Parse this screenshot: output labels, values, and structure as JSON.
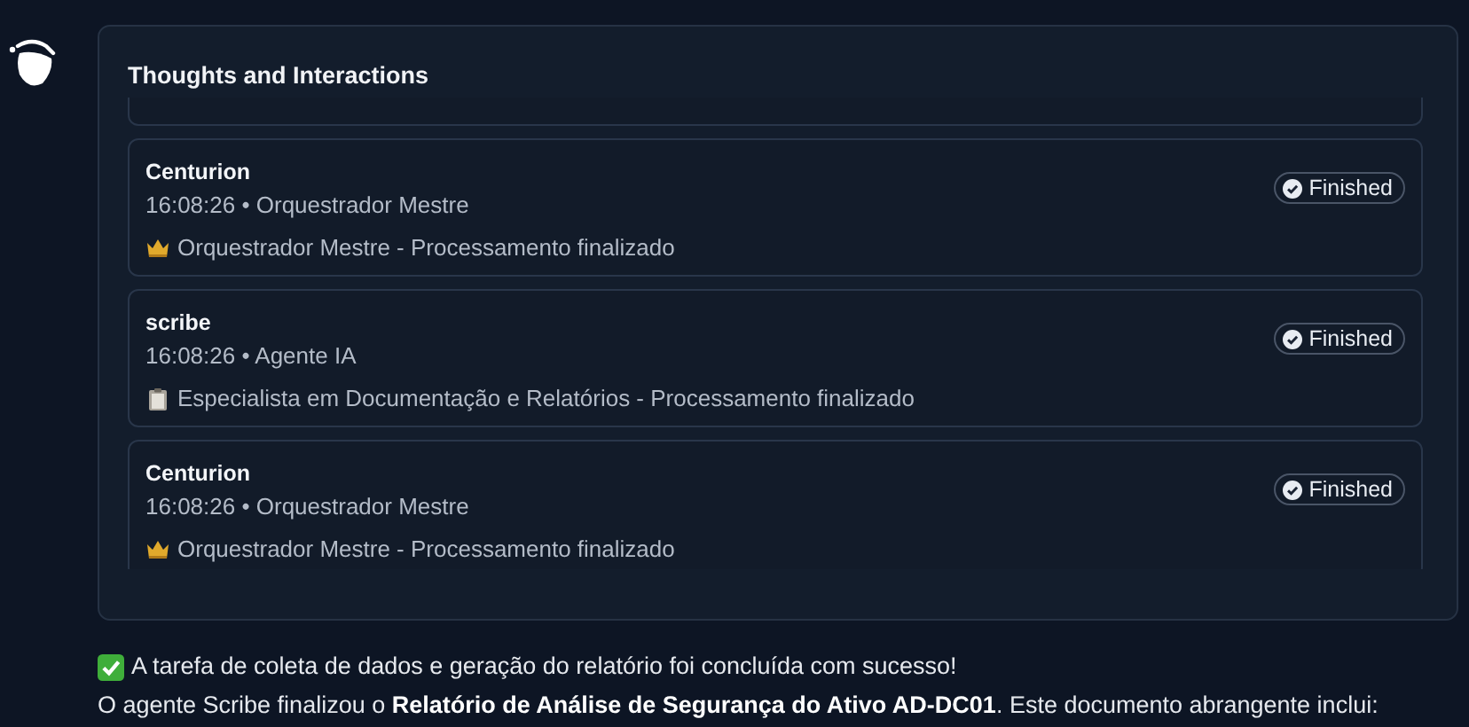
{
  "panel": {
    "title": "Thoughts and Interactions"
  },
  "entries": [
    {
      "agent": "Centurion",
      "meta": "16:08:26 • Orquestrador Mestre",
      "kind": "orchestrator",
      "message": "Orquestrador Mestre - Processamento finalizado",
      "status": "Finished"
    },
    {
      "agent": "scribe",
      "meta": "16:08:26 • Agente IA",
      "kind": "agent",
      "message": "Especialista em Documentação e Relatórios - Processamento finalizado",
      "status": "Finished"
    },
    {
      "agent": "Centurion",
      "meta": "16:08:26 • Orquestrador Mestre",
      "kind": "orchestrator",
      "message": "Orquestrador Mestre - Processamento finalizado",
      "status": "Finished"
    }
  ],
  "reply": {
    "success": "A tarefa de coleta de dados e geração do relatório foi concluída com sucesso!",
    "summary": "O agente Scribe finalizou o **Relatório de Análise de Segurança do Ativo AD-DC01**. Este documento abrangente inclui:"
  }
}
